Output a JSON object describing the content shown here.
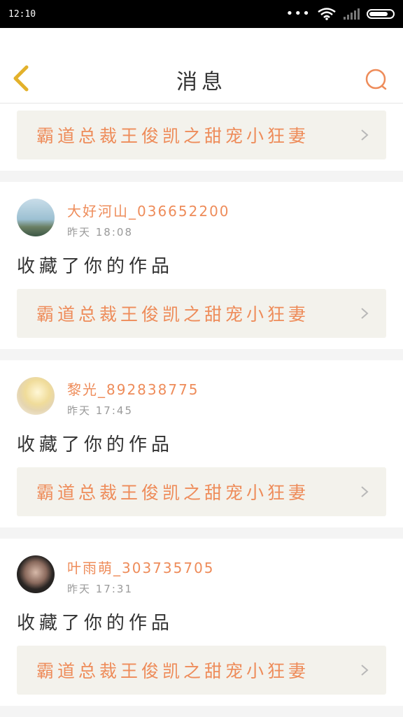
{
  "status_bar": {
    "time": "12:10",
    "dots": "•••"
  },
  "header": {
    "title": "消息"
  },
  "top_card": {
    "work_title": "霸道总裁王俊凯之甜宠小狂妻"
  },
  "messages": [
    {
      "user": "大好河山_036652200",
      "time": "昨天 18:08",
      "action": "收藏了你的作品",
      "work_title": "霸道总裁王俊凯之甜宠小狂妻"
    },
    {
      "user": "黎光_892838775",
      "time": "昨天 17:45",
      "action": "收藏了你的作品",
      "work_title": "霸道总裁王俊凯之甜宠小狂妻"
    },
    {
      "user": "叶雨萌_303735705",
      "time": "昨天 17:31",
      "action": "收藏了你的作品",
      "work_title": "霸道总裁王俊凯之甜宠小狂妻"
    }
  ],
  "colors": {
    "accent": "#ee8c5a",
    "link_bg": "#f3f2ec",
    "page_bg": "#f4f4f4"
  },
  "icons": {
    "back": "chevron-left-icon",
    "search": "search-icon",
    "chevron": "chevron-right-icon"
  }
}
